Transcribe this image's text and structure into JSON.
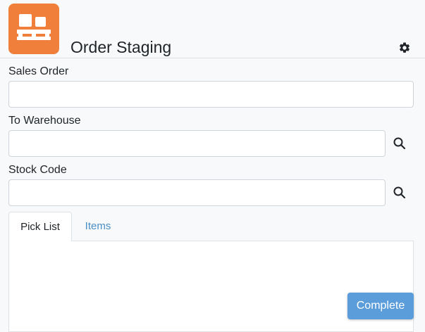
{
  "header": {
    "title": "Order Staging",
    "logo_icon": "pallet-boxes-icon",
    "settings_icon": "gear-icon",
    "logo_color": "#f07f3c"
  },
  "form": {
    "sales_order": {
      "label": "Sales Order",
      "value": ""
    },
    "to_warehouse": {
      "label": "To Warehouse",
      "value": "",
      "lookup_icon": "search-icon"
    },
    "stock_code": {
      "label": "Stock Code",
      "value": "",
      "lookup_icon": "search-icon"
    }
  },
  "tabs": [
    {
      "label": "Pick List",
      "active": true
    },
    {
      "label": "Items",
      "active": false
    }
  ],
  "actions": {
    "complete_label": "Complete",
    "complete_color": "#5b9ddb"
  }
}
